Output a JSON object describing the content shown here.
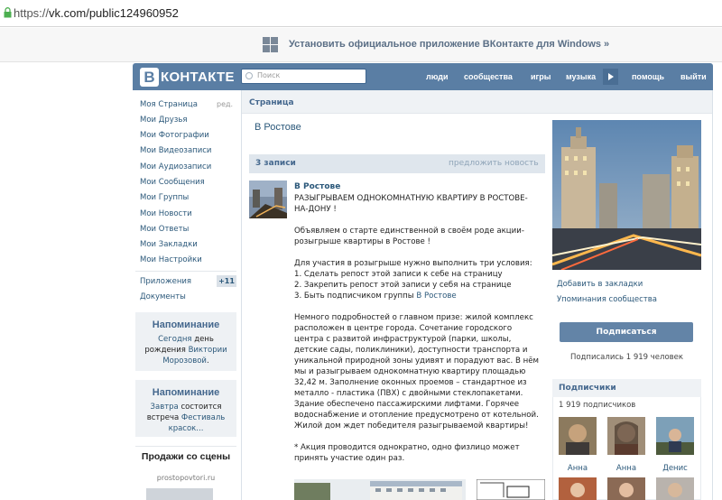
{
  "browser": {
    "url_scheme": "https://",
    "url_host_path": "vk.com/public124960952"
  },
  "banner": {
    "text": "Установить официальное приложение ВКонтакте для Windows »",
    "icon": "windows-logo-icon"
  },
  "header": {
    "logo_letter": "В",
    "logo_text": "КОНТАКТЕ",
    "search_placeholder": "Поиск",
    "nav": [
      "люди",
      "сообщества",
      "игры",
      "музыка",
      "помощь",
      "выйти"
    ]
  },
  "left_menu": {
    "edit_label": "ред.",
    "items": [
      "Моя Страница",
      "Мои Друзья",
      "Мои Фотографии",
      "Мои Видеозаписи",
      "Мои Аудиозаписи",
      "Мои Сообщения",
      "Мои Группы",
      "Мои Новости",
      "Мои Ответы",
      "Мои Закладки",
      "Мои Настройки"
    ],
    "apps_label": "Приложения",
    "apps_badge": "+11",
    "docs_label": "Документы"
  },
  "reminders": [
    {
      "title": "Напоминание",
      "line1_a": "Сегодня",
      "line1_b": " день",
      "line2_a": "рождения ",
      "line2_b": "Виктории",
      "line3": "Морозовой",
      "line3_b": "."
    },
    {
      "title": "Напоминание",
      "line1_a": "Завтра",
      "line1_b": " состоится",
      "line2_a": "встреча ",
      "line2_b": "Фестиваль",
      "line3": "красок..."
    }
  ],
  "ad": {
    "title": "Продажи со сцены",
    "site": "prostopovtori.ru"
  },
  "content": {
    "breadcrumb": "Страница",
    "page_name": "В Ростове",
    "wall_count": "3 записи",
    "suggest": "предложить новость"
  },
  "post": {
    "author": "В Ростове",
    "headline": "РАЗЫГРЫВАЕМ ОДНОКОМНАТНУЮ КВАРТИРУ В РОСТОВЕ-НА-ДОНУ !",
    "p1": "Объявляем о старте единственной в своём роде акции-розыгрыше квартиры в Ростове !",
    "p2_intro": "Для участия в розыгрыше нужно выполнить три условия:",
    "p2_c1": "1. Сделать репост этой записи к себе на страницу",
    "p2_c2": "2. Закрепить репост этой записи у себя на странице",
    "p2_c3": "3. Быть подписчиком группы ",
    "p2_c3_link": "В Ростове",
    "p3": "Немного подробностей о главном призе: жилой комплекс расположен в центре города. Сочетание городского центра с развитой инфраструктурой (парки, школы, детские сады, поликлиники), доступности транспорта и уникальной природной зоны удивят и порадуют вас. В нём мы и разыгрываем однокомнатную квартиру площадью 32,42 м. Заполнение оконных проемов – стандартное из металло - пластика (ПВХ) с двойными стеклопакетами. Здание обеспечено пассажирскими лифтами. Горячее водоснабжение и отопление предусмотрено от котельной. Жилой дом ждет победителя разыгрываемой квартиры!",
    "p4": "* Акция проводится однократно, одно физлицо может принять участие один раз."
  },
  "right": {
    "bookmark": "Добавить в закладки",
    "mentions": "Упоминания сообщества",
    "subscribe": "Подписаться",
    "subscribed": "Подписались 1 919 человек",
    "subs_title": "Подписчики",
    "subs_count": "1 919 подписчиков",
    "subscribers": [
      "Анна",
      "Анна",
      "Денис"
    ]
  },
  "colors": {
    "header_blue": "#5a7ea4",
    "link_blue": "#2b587a",
    "button_blue": "#6384a7"
  }
}
